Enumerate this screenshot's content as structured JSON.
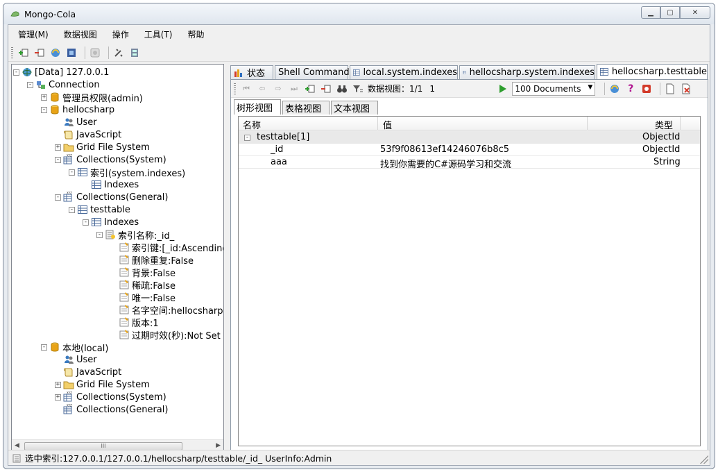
{
  "window": {
    "title": "Mongo-Cola"
  },
  "menu": [
    "管理(M)",
    "数据视图",
    "操作",
    "工具(T)",
    "帮助"
  ],
  "tree": {
    "nodes": [
      {
        "label": "[Data]  127.0.0.1",
        "icon": "server-icon"
      },
      {
        "label": "Connection",
        "icon": "connection-icon"
      },
      {
        "label": "管理员权限(admin)",
        "icon": "database-icon"
      },
      {
        "label": "hellocsharp",
        "icon": "database-icon"
      },
      {
        "label": "User",
        "icon": "users-icon"
      },
      {
        "label": "JavaScript",
        "icon": "script-icon"
      },
      {
        "label": "Grid File System",
        "icon": "folder-icon"
      },
      {
        "label": "Collections(System)",
        "icon": "collections-icon"
      },
      {
        "label": "索引(system.indexes)",
        "icon": "table-icon"
      },
      {
        "label": "Indexes",
        "icon": "table-icon"
      },
      {
        "label": "Collections(General)",
        "icon": "collections-icon"
      },
      {
        "label": "testtable",
        "icon": "table-icon"
      },
      {
        "label": "Indexes",
        "icon": "table-icon"
      },
      {
        "label": "索引名称:_id_",
        "icon": "index-icon"
      },
      {
        "label": "索引键:[_id:Ascending]",
        "icon": "property-icon"
      },
      {
        "label": "删除重复:False",
        "icon": "property-icon"
      },
      {
        "label": "背景:False",
        "icon": "property-icon"
      },
      {
        "label": "稀疏:False",
        "icon": "property-icon"
      },
      {
        "label": "唯一:False",
        "icon": "property-icon"
      },
      {
        "label": "名字空间:hellocsharp.testtable",
        "icon": "property-icon"
      },
      {
        "label": "版本:1",
        "icon": "property-icon"
      },
      {
        "label": "过期时效(秒):Not Set",
        "icon": "property-icon"
      },
      {
        "label": "本地(local)",
        "icon": "database-icon"
      },
      {
        "label": "User",
        "icon": "users-icon"
      },
      {
        "label": "JavaScript",
        "icon": "script-icon"
      },
      {
        "label": "Grid File System",
        "icon": "folder-icon"
      },
      {
        "label": "Collections(System)",
        "icon": "collections-icon"
      },
      {
        "label": "Collections(General)",
        "icon": "collections-icon"
      }
    ],
    "scroll_grip": "III"
  },
  "doc_tabs": [
    "状态",
    "Shell Command",
    "local.system.indexes",
    "hellocsharp.system.indexes",
    "hellocsharp.testtable"
  ],
  "query_bar": {
    "page_label": "数据视图：1/1",
    "page_input": "1",
    "docs_per_page": "100  Documents"
  },
  "view_tabs": [
    "树形视图",
    "表格视图",
    "文本视图"
  ],
  "grid": {
    "columns": [
      "名称",
      "值",
      "类型"
    ],
    "group": {
      "name": "testtable[1]",
      "type": "ObjectId"
    },
    "rows": [
      {
        "name": "_id",
        "value": "53f9f08613ef14246076b8c5",
        "type": "ObjectId"
      },
      {
        "name": "aaa",
        "value": "找到你需要的C#源码学习和交流",
        "type": "String"
      }
    ]
  },
  "status": {
    "text": "选中索引:127.0.0.1/127.0.0.1/hellocsharp/testtable/_id_  UserInfo:Admin"
  },
  "colors": {
    "accent": "#3a6fb0",
    "db": "#e8a317",
    "green": "#2e9e2e",
    "red": "#d23a2a"
  }
}
